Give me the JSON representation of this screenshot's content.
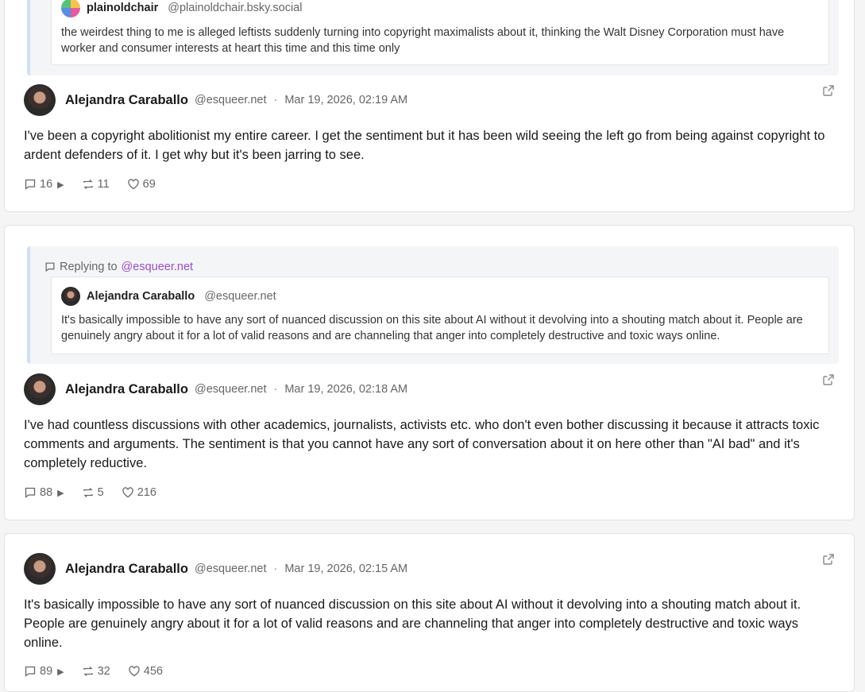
{
  "icons": {
    "comment": "comment-icon",
    "expand": "expand-replies-icon",
    "repost": "repost-icon",
    "like": "heart-icon",
    "external": "external-link-icon"
  },
  "colors": {
    "mention": "#9b4dca",
    "quote_bar": "#cfe0f6"
  },
  "posts": [
    {
      "quote": {
        "author_name": "plainoldchair",
        "author_handle": "@plainoldchair.bsky.social",
        "text": "the weirdest thing to me is alleged leftists suddenly turning into copyright maximalists about it, thinking the Walt Disney Corporation must have worker and consumer interests at heart this time and this time only"
      },
      "author_name": "Alejandra Caraballo",
      "author_handle": "@esqueer.net",
      "separator": "·",
      "date": "Mar 19, 2026, 02:19 AM",
      "text": "I've been a copyright abolitionist my entire career. I get the sentiment but it has been wild seeing the left go from being against copyright to ardent defenders of it. I get why but it's been jarring to see.",
      "replies": "16",
      "reposts": "11",
      "likes": "69"
    },
    {
      "replying_label": "Replying to",
      "replying_to": "@esqueer.net",
      "quote": {
        "author_name": "Alejandra Caraballo",
        "author_handle": "@esqueer.net",
        "text": "It's basically impossible to have any sort of nuanced discussion on this site about AI without it devolving into a shouting match about it. People are genuinely angry about it for a lot of valid reasons and are channeling that anger into completely destructive and toxic ways online."
      },
      "author_name": "Alejandra Caraballo",
      "author_handle": "@esqueer.net",
      "separator": "·",
      "date": "Mar 19, 2026, 02:18 AM",
      "text": "I've had countless discussions with other academics, journalists, activists etc. who don't even bother discussing it because it attracts toxic comments and arguments. The sentiment is that you cannot have any sort of conversation about it on here other than \"AI bad\" and it's completely reductive.",
      "replies": "88",
      "reposts": "5",
      "likes": "216"
    },
    {
      "author_name": "Alejandra Caraballo",
      "author_handle": "@esqueer.net",
      "separator": "·",
      "date": "Mar 19, 2026, 02:15 AM",
      "text": "It's basically impossible to have any sort of nuanced discussion on this site about AI without it devolving into a shouting match about it. People are genuinely angry about it for a lot of valid reasons and are channeling that anger into completely destructive and toxic ways online.",
      "replies": "89",
      "reposts": "32",
      "likes": "456"
    }
  ]
}
